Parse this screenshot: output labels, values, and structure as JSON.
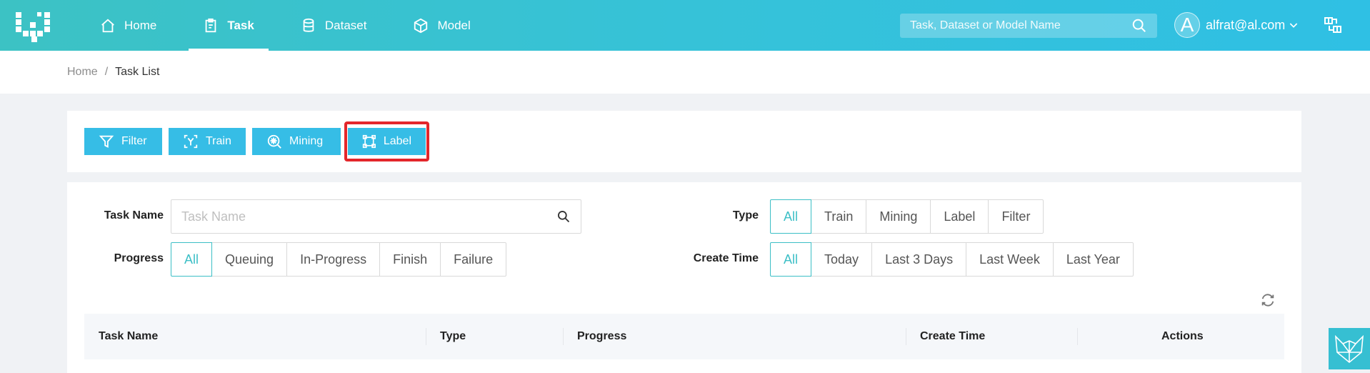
{
  "colors": {
    "accent": "#36bde6",
    "highlight": "#e3262b",
    "teal": "#3cbfc6"
  },
  "nav": {
    "items": [
      {
        "label": "Home",
        "icon": "home-icon"
      },
      {
        "label": "Task",
        "icon": "clipboard-icon",
        "active": true
      },
      {
        "label": "Dataset",
        "icon": "database-icon"
      },
      {
        "label": "Model",
        "icon": "cube-icon"
      }
    ]
  },
  "search": {
    "placeholder": "Task, Dataset or Model Name"
  },
  "user": {
    "initial": "A",
    "email": "alfrat@al.com"
  },
  "breadcrumb": {
    "home": "Home",
    "separator": "/",
    "current": "Task List"
  },
  "toolbar": {
    "filter": "Filter",
    "train": "Train",
    "mining": "Mining",
    "label": "Label"
  },
  "filters": {
    "task_name_label": "Task Name",
    "task_name_placeholder": "Task Name",
    "type_label": "Type",
    "type_options": [
      "All",
      "Train",
      "Mining",
      "Label",
      "Filter"
    ],
    "type_selected": "All",
    "progress_label": "Progress",
    "progress_options": [
      "All",
      "Queuing",
      "In-Progress",
      "Finish",
      "Failure"
    ],
    "progress_selected": "All",
    "create_time_label": "Create Time",
    "create_time_options": [
      "All",
      "Today",
      "Last 3 Days",
      "Last Week",
      "Last Year"
    ],
    "create_time_selected": "All"
  },
  "table": {
    "columns": [
      "Task Name",
      "Type",
      "Progress",
      "Create Time",
      "Actions"
    ]
  }
}
